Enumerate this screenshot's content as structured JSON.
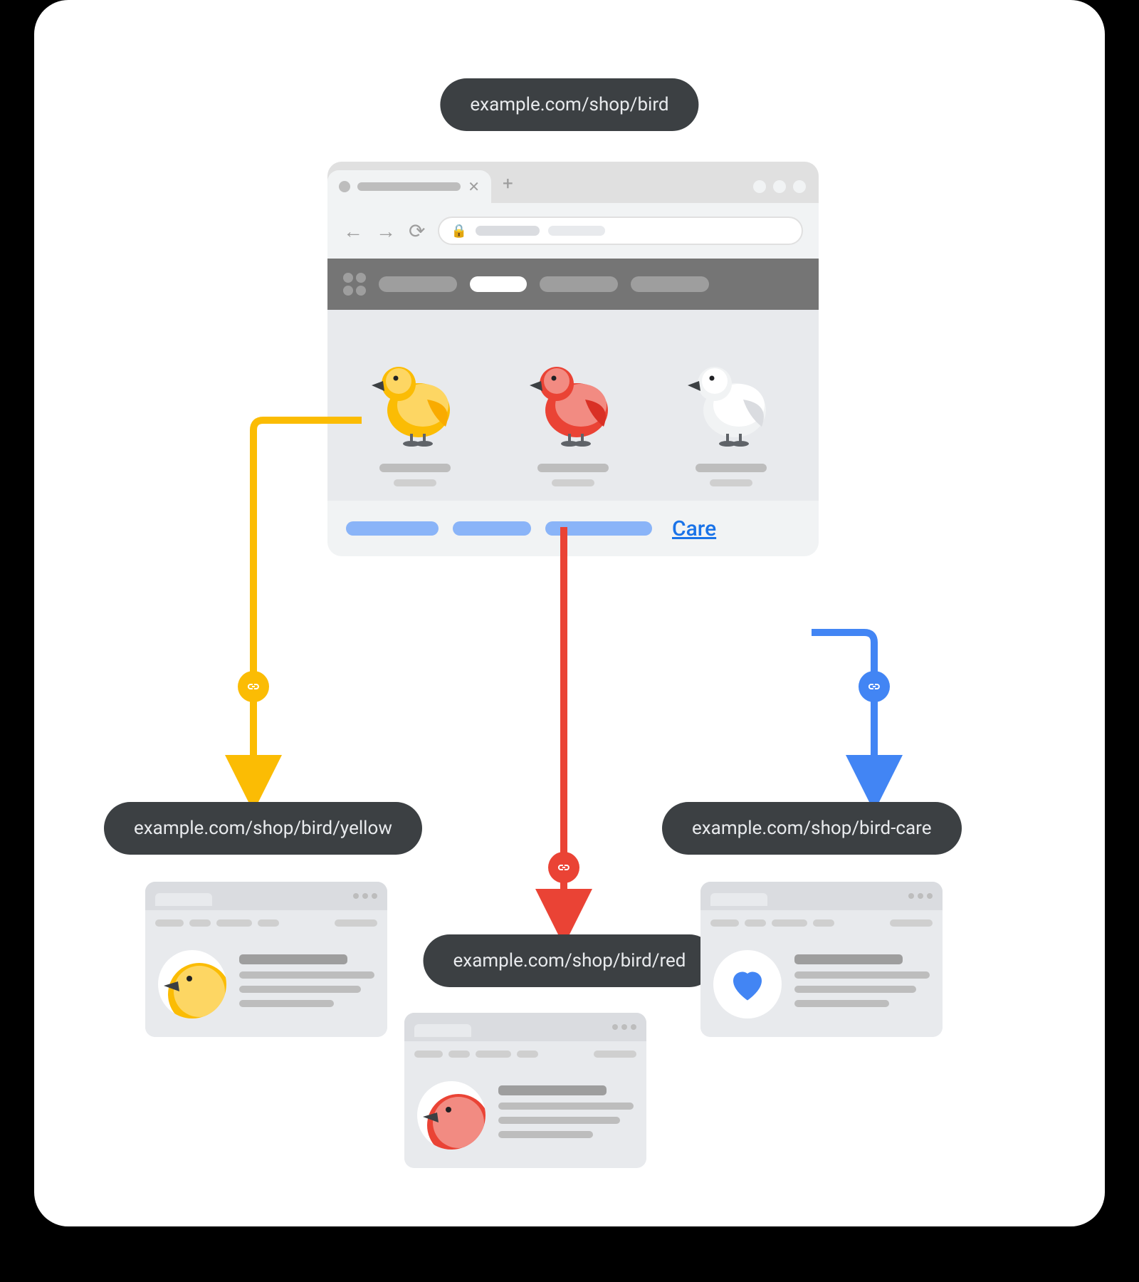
{
  "urls": {
    "parent": "example.com/shop/bird",
    "yellow": "example.com/shop/bird/yellow",
    "red": "example.com/shop/bird/red",
    "care": "example.com/shop/bird-care"
  },
  "footer": {
    "care_label": "Care"
  },
  "colors": {
    "yellow": "#fbbc04",
    "red": "#ea4335",
    "blue": "#4285f4",
    "pill": "#3c4043"
  },
  "birds": [
    "yellow",
    "red",
    "white"
  ]
}
